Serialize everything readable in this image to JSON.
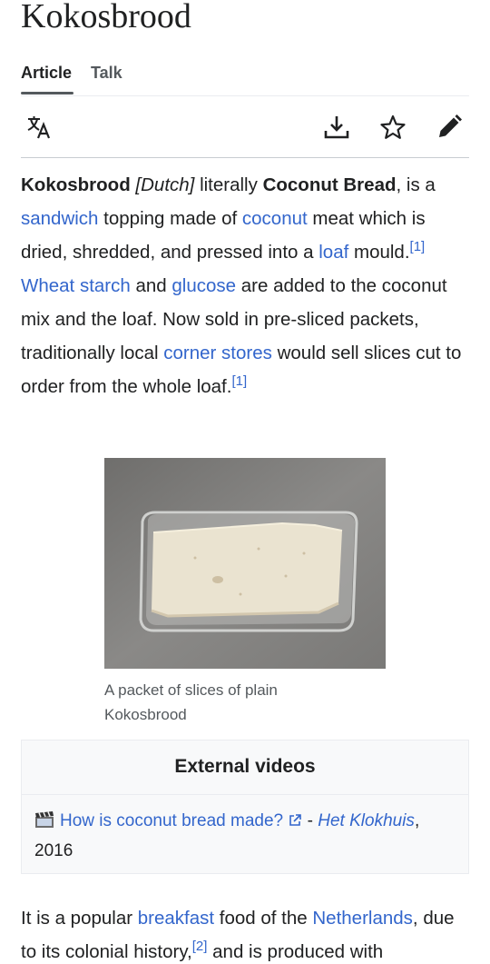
{
  "page": {
    "title": "Kokosbrood"
  },
  "tabs": [
    {
      "label": "Article"
    },
    {
      "label": "Talk"
    }
  ],
  "toolbar": {
    "language_icon": "translate-icon",
    "download_icon": "download-icon",
    "watch_icon": "star-icon",
    "edit_icon": "pencil-icon"
  },
  "intro": {
    "term": "Kokosbrood",
    "lang": "[Dutch]",
    "t1": " literally ",
    "translation": "Coconut Bread",
    "t2": ", is a ",
    "link_sandwich": "sandwich",
    "t3": " topping made of ",
    "link_coconut": "coconut",
    "t4": " meat which is dried, shredded, and pressed into a ",
    "link_loaf": "loaf",
    "t5": " mould.",
    "ref1": "[1]",
    "t6": " ",
    "link_wheat": "Wheat starch",
    "t7": " and ",
    "link_glucose": "glucose",
    "t8": " are added to the coconut mix and the loaf. Now sold in pre-sliced packets, traditionally local ",
    "link_corner": "corner stores",
    "t9": " would sell slices cut to order from the whole loaf.",
    "ref2": "[1]"
  },
  "figure": {
    "caption": "A packet of slices of plain Kokosbrood"
  },
  "videos": {
    "heading": "External videos",
    "item_link": "How is coconut bread made?",
    "sep": " - ",
    "source": "Het Klokhuis",
    "comma": ",",
    "year": "2016"
  },
  "para2": {
    "t1": "It is a popular ",
    "link_breakfast": "breakfast",
    "t2": " food of the ",
    "link_nl": "Netherlands",
    "t3": ", due to its colonial history,",
    "ref": "[2]",
    "t4": " and is produced with"
  },
  "colors": {
    "link": "#3366cc",
    "text": "#202122",
    "muted": "#54595d"
  }
}
